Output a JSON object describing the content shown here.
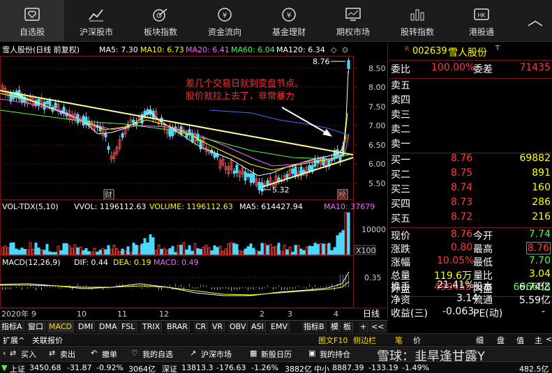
{
  "nav": [
    {
      "label": "自选股",
      "icon": "heart-icon"
    },
    {
      "label": "沪深股市",
      "icon": "line-chart-icon"
    },
    {
      "label": "板块指数",
      "icon": "target-chart-icon"
    },
    {
      "label": "资金流向",
      "icon": "yen-coin-icon"
    },
    {
      "label": "基金理财",
      "icon": "yen-coin-icon"
    },
    {
      "label": "期权市场",
      "icon": "monitor-chart-icon"
    },
    {
      "label": "股转指数",
      "icon": "bar-chart-icon"
    },
    {
      "label": "港股通",
      "icon": "hk-icon"
    }
  ],
  "back_icon": "chevron-up-icon",
  "chart": {
    "title": "雪人股份(日线 前复权)",
    "ma": {
      "ma5": "MA5: 7.30",
      "ma10": "MA10: 6.73",
      "ma20": "MA20: 6.41",
      "ma60": "MA60: 6.04",
      "ma120": "MA120: 6.34"
    },
    "annotation_line1": "差几个交易日就到变盘节点。",
    "annotation_line2": "股价就拉上去了，非常暴力",
    "high_label": "8.76",
    "low_label": "5.32",
    "marker_cai": "财",
    "marker_bang": "榜",
    "y_ticks": [
      "8.50",
      "8.00",
      "7.50",
      "7.00",
      "6.50",
      "6.00",
      "5.50"
    ],
    "vol": {
      "name": "VOL-TDX(5,10)",
      "vvol": "VVOL: 1196112.63",
      "volume": "VOLUME: 1196112.63",
      "ma5": "MA5: 614427.94",
      "ma10": "MA10: 37679",
      "tick": "10000",
      "unit": "X100"
    },
    "macd": {
      "name": "MACD(12,26,9)",
      "dif": "DIF: 0.44",
      "dea": "DEA: 0.19",
      "macd": "MACD: 0.49",
      "tick": "0.35"
    },
    "x_labels": [
      "2020年",
      "9",
      "10",
      "11",
      "12",
      "2",
      "3",
      "4"
    ],
    "period": "日线"
  },
  "quote": {
    "code": "002639",
    "name": "雪人股份",
    "tag": "R",
    "t": "T",
    "weibi_label": "委比",
    "weibi": "100.00%",
    "weicha_label": "委差",
    "weicha": "71435",
    "sells": [
      {
        "label": "卖五"
      },
      {
        "label": "卖四"
      },
      {
        "label": "卖三"
      },
      {
        "label": "卖二"
      },
      {
        "label": "卖一"
      }
    ],
    "buys": [
      {
        "label": "买一",
        "price": "8.76",
        "vol": "69882"
      },
      {
        "label": "买二",
        "price": "8.75",
        "vol": "891"
      },
      {
        "label": "买三",
        "price": "8.74",
        "vol": "160"
      },
      {
        "label": "买四",
        "price": "8.73",
        "vol": "286"
      },
      {
        "label": "买五",
        "price": "8.72",
        "vol": "216"
      }
    ],
    "xianjia_l": "现价",
    "xianjia": "8.76",
    "jinkai_l": "今开",
    "jinkai": "7.74",
    "zhangdie_l": "涨跌",
    "zhangdie": "0.80",
    "zuigao_l": "最高",
    "zuigao": "8.76",
    "zhangfu_l": "涨幅",
    "zhangfu": "10.05%",
    "zuidi_l": "最低",
    "zuidi": "7.70",
    "zongliang_l": "总量",
    "zongliang": "119.6万",
    "liangbi_l": "量比",
    "liangbi": "3.04",
    "waipan_l": "外盘",
    "waipan": "499455",
    "neipan_l": "内盘",
    "neipan": "696658",
    "huanshou_l": "换手",
    "huanshou": "21.41%",
    "guben_l": "股本",
    "guben": "6.74亿",
    "jingzi_l": "净资",
    "jingzi": "3.14",
    "liutong_l": "流通",
    "liutong": "5.59亿",
    "shouyi_l": "收益(三)",
    "shouyi": "-0.063",
    "pe_l": "PE(动)",
    "pe": "-"
  },
  "indicators": [
    "指标A",
    "窗口",
    "MACD",
    "DMI",
    "DMA",
    "FSL",
    "TRIX",
    "BRAR",
    "CR",
    "VR",
    "OBV",
    "ASI",
    "EMV",
    "指标B",
    "模",
    "板",
    "+",
    "<<"
  ],
  "bar2": {
    "left": "扩展^",
    "left2": "关联报价",
    "right": [
      "图文F10",
      "侧边栏",
      "笔",
      "价",
      "细",
      "盘",
      "值",
      "主",
      "<"
    ]
  },
  "bar3": [
    "买入",
    "卖出",
    "撤单",
    "我的自选",
    "沪深市场",
    "新股日历",
    "我的持仓"
  ],
  "watermark": "雪球：韭旱逢甘露Y",
  "ticker": [
    {
      "name": "上证",
      "value": "3450.68",
      "chg": "-31.87",
      "pct": "-0.92%",
      "amt": "3064亿"
    },
    {
      "name": "深证",
      "value": "13813.3",
      "chg": "-176.63",
      "pct": "-1.26%",
      "amt": "3882亿"
    },
    {
      "name": "中小",
      "value": "8887.39",
      "chg": "-133.19",
      "pct": "-1.49%",
      "amt": "482.5亿"
    }
  ]
}
